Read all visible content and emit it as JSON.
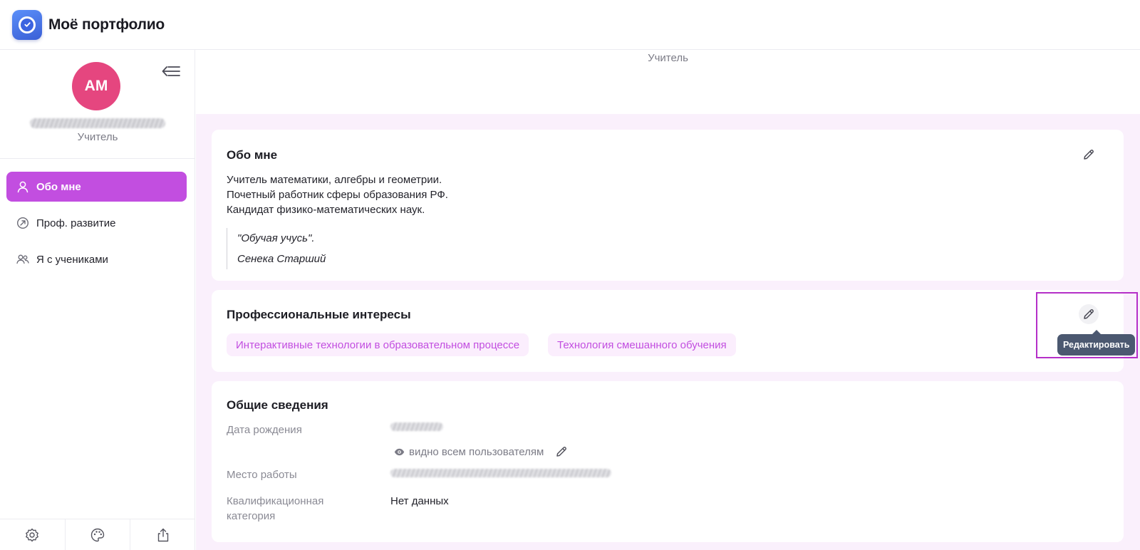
{
  "app": {
    "title": "Моё портфолио"
  },
  "profile": {
    "initials": "АМ",
    "role": "Учитель"
  },
  "sidebar": {
    "items": [
      {
        "label": "Обо мне",
        "icon": "user-icon",
        "active": true
      },
      {
        "label": "Проф. развитие",
        "icon": "growth-arrow-icon",
        "active": false
      },
      {
        "label": "Я с учениками",
        "icon": "users-icon",
        "active": false
      }
    ],
    "bottom_icons": [
      "settings-icon",
      "palette-icon",
      "share-icon"
    ]
  },
  "header": {
    "role": "Учитель"
  },
  "about": {
    "title": "Обо мне",
    "lines": [
      "Учитель математики, алгебры и геометрии.",
      "Почетный работник сферы образования РФ.",
      "Кандидат физико-математических наук."
    ],
    "quote": "\"Обучая учусь\".",
    "quote_author": "Сенека Старший"
  },
  "interests": {
    "title": "Профессиональные интересы",
    "tags": [
      "Интерактивные технологии в образовательном процессе",
      "Технология смешанного обучения"
    ],
    "edit_tooltip": "Редактировать"
  },
  "general": {
    "title": "Общие сведения",
    "birth_label": "Дата рождения",
    "visibility": "видно всем пользователям",
    "work_label": "Место работы",
    "category_label": "Квалификационная категория",
    "category_value": "Нет данных"
  },
  "colors": {
    "accent": "#c24ee0",
    "avatar": "#e5467f",
    "tag_bg": "#fbeefd",
    "main_bg": "#faf0fc",
    "tooltip_bg": "#4b5870",
    "highlight": "#b52fc8"
  }
}
